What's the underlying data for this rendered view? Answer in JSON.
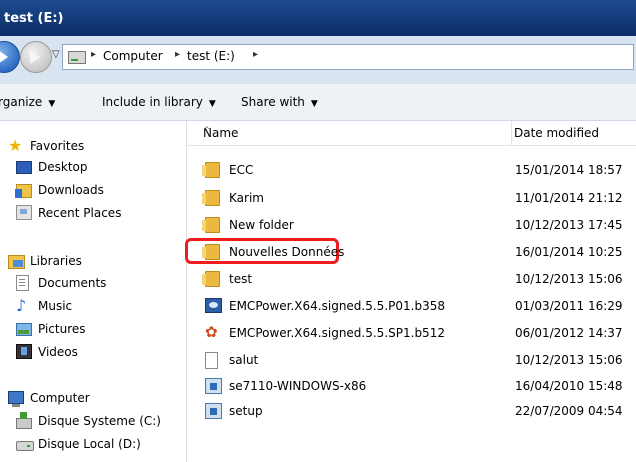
{
  "window": {
    "title": "test (E:)"
  },
  "navigation": {
    "breadcrumb": [
      "Computer",
      "test (E:)"
    ]
  },
  "toolbar": {
    "organize_label": "rganize",
    "include_label": "Include in library",
    "share_label": "Share with"
  },
  "sidebar": {
    "favorites": {
      "label": "Favorites",
      "items": [
        "Desktop",
        "Downloads",
        "Recent Places"
      ]
    },
    "libraries": {
      "label": "Libraries",
      "items": [
        "Documents",
        "Music",
        "Pictures",
        "Videos"
      ]
    },
    "computer": {
      "label": "Computer",
      "items": [
        "Disque Systeme (C:)",
        "Disque Local (D:)"
      ]
    }
  },
  "columns": {
    "name": "Name",
    "date": "Date modified"
  },
  "files": [
    {
      "name": "ECC",
      "date": "15/01/2014 18:57",
      "icon": "folder-icon"
    },
    {
      "name": "Karim",
      "date": "11/01/2014 21:12",
      "icon": "folder-icon"
    },
    {
      "name": "New folder",
      "date": "10/12/2013 17:45",
      "icon": "folder-icon"
    },
    {
      "name": "Nouvelles Données",
      "date": "16/01/2014 10:25",
      "icon": "folder-icon",
      "highlighted": true
    },
    {
      "name": "test",
      "date": "10/12/2013 15:06",
      "icon": "folder-icon"
    },
    {
      "name": "EMCPower.X64.signed.5.5.P01.b358",
      "date": "01/03/2011 16:29",
      "icon": "installer-icon"
    },
    {
      "name": "EMCPower.X64.signed.5.5.SP1.b512",
      "date": "06/01/2012 14:37",
      "icon": "leaf-icon"
    },
    {
      "name": "salut",
      "date": "10/12/2013 15:06",
      "icon": "text-file-icon"
    },
    {
      "name": "se7110-WINDOWS-x86",
      "date": "16/04/2010 15:48",
      "icon": "setup-icon"
    },
    {
      "name": "setup",
      "date": "22/07/2009 04:54",
      "icon": "setup-icon"
    }
  ],
  "colors": {
    "highlight": "#ee1c1c",
    "title_bar": "#0b2d66"
  }
}
